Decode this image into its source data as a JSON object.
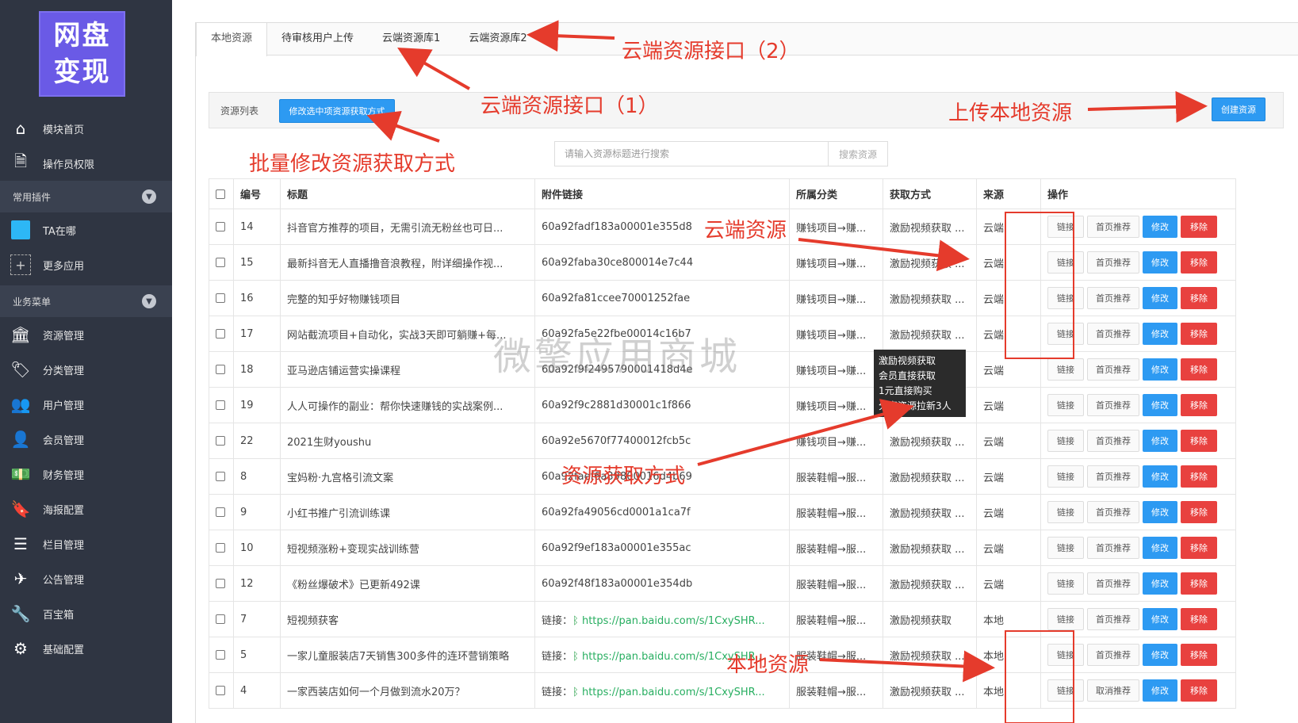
{
  "logo": {
    "line1": "网盘",
    "line2": "变现"
  },
  "sidebar": {
    "top_items": [
      {
        "label": "模块首页",
        "icon": "home-icon"
      },
      {
        "label": "操作员权限",
        "icon": "document-icon"
      }
    ],
    "group_plugins": "常用插件",
    "plugins": [
      {
        "label": "TA在哪",
        "icon": "ta-icon"
      },
      {
        "label": "更多应用",
        "icon": "plus-icon"
      }
    ],
    "group_business": "业务菜单",
    "business": [
      {
        "label": "资源管理",
        "icon": "bank-icon"
      },
      {
        "label": "分类管理",
        "icon": "tag-icon"
      },
      {
        "label": "用户管理",
        "icon": "users-icon"
      },
      {
        "label": "会员管理",
        "icon": "user-icon"
      },
      {
        "label": "财务管理",
        "icon": "money-icon"
      },
      {
        "label": "海报配置",
        "icon": "bookmark-icon"
      },
      {
        "label": "栏目管理",
        "icon": "list-icon"
      },
      {
        "label": "公告管理",
        "icon": "send-icon"
      },
      {
        "label": "百宝箱",
        "icon": "wrench-icon"
      },
      {
        "label": "基础配置",
        "icon": "gears-icon"
      }
    ]
  },
  "tabs": [
    "本地资源",
    "待审核用户上传",
    "云端资源库1",
    "云端资源库2"
  ],
  "toolbar": {
    "list_label": "资源列表",
    "bulk_button": "修改选中项资源获取方式",
    "create_button": "创建资源"
  },
  "search": {
    "placeholder": "请输入资源标题进行搜索",
    "button": "搜索资源"
  },
  "table": {
    "headers": [
      "编号",
      "标题",
      "附件链接",
      "所属分类",
      "获取方式",
      "来源",
      "操作"
    ],
    "op_labels": {
      "link": "链接",
      "home": "首页推荐",
      "home_cancel": "取消推荐",
      "edit": "修改",
      "del": "移除"
    },
    "link_prefix": "链接：",
    "rows": [
      {
        "id": "14",
        "title": "抖音官方推荐的项目，无需引流无粉丝也可日...",
        "attach": "60a92fadf183a00001e355d8",
        "category": "赚钱项目→赚...",
        "method": "激励视频获取 ...",
        "source": "云端"
      },
      {
        "id": "15",
        "title": "最新抖音无人直播撸音浪教程，附详细操作视...",
        "attach": "60a92faba30ce800014e7c44",
        "category": "赚钱项目→赚...",
        "method": "激励视频获取 ...",
        "source": "云端"
      },
      {
        "id": "16",
        "title": "完整的知乎好物赚钱项目",
        "attach": "60a92fa81ccee70001252fae",
        "category": "赚钱项目→赚...",
        "method": "激励视频获取 ...",
        "source": "云端"
      },
      {
        "id": "17",
        "title": "网站截流项目+自动化，实战3天即可躺赚+每...",
        "attach": "60a92fa5e22fbe00014c16b7",
        "category": "赚钱项目→赚...",
        "method": "激励视频获取 ...",
        "source": "云端"
      },
      {
        "id": "18",
        "title": "亚马逊店铺运营实操课程",
        "attach": "60a92f9f2495790001418d4e",
        "category": "赚钱项目→赚...",
        "method": "",
        "source": "云端"
      },
      {
        "id": "19",
        "title": "人人可操作的副业：帮你快速赚钱的实战案例...",
        "attach": "60a92f9c2881d30001c1f866",
        "category": "赚钱项目→赚...",
        "method": "",
        "source": "云端"
      },
      {
        "id": "22",
        "title": "2021生财youshu",
        "attach": "60a92e5670f77400012fcb5c",
        "category": "赚钱项目→赚...",
        "method": "激励视频获取 ...",
        "source": "云端"
      },
      {
        "id": "8",
        "title": "宝妈粉·九宫格引流文案",
        "attach": "60a92faef6a39800016d4b69",
        "category": "服装鞋帽→服...",
        "method": "激励视频获取 ...",
        "source": "云端"
      },
      {
        "id": "9",
        "title": "小红书推广引流训练课",
        "attach": "60a92fa49056cd0001a1ca7f",
        "category": "服装鞋帽→服...",
        "method": "激励视频获取 ...",
        "source": "云端"
      },
      {
        "id": "10",
        "title": "短视频涨粉+变现实战训练营",
        "attach": "60a92f9ef183a00001e355ac",
        "category": "服装鞋帽→服...",
        "method": "激励视频获取 ...",
        "source": "云端"
      },
      {
        "id": "12",
        "title": "《粉丝爆破术》已更新492课",
        "attach": "60a92f48f183a00001e354db",
        "category": "服装鞋帽→服...",
        "method": "激励视频获取 ...",
        "source": "云端"
      },
      {
        "id": "7",
        "title": "短视频获客",
        "attach": "https://pan.baidu.com/s/1CxySHR...",
        "category": "服装鞋帽→服...",
        "method": "激励视频获取",
        "source": "本地"
      },
      {
        "id": "5",
        "title": "一家儿童服装店7天销售300多件的连环营销策略",
        "attach": "https://pan.baidu.com/s/1CxySHR...",
        "category": "服装鞋帽→服...",
        "method": "激励视频获取 ...",
        "source": "本地"
      },
      {
        "id": "4",
        "title": "一家西装店如何一个月做到流水20万？",
        "attach": "https://pan.baidu.com/s/1CxySHR...",
        "category": "服装鞋帽→服...",
        "method": "激励视频获取 ...",
        "source": "本地"
      }
    ]
  },
  "tooltip": [
    "激励视频获取",
    "会员直接获取",
    "1元直接购买",
    "分享资源拉新3人"
  ],
  "watermark": "微擎应用商城",
  "annotations": {
    "cloud_api_2": "云端资源接口（2）",
    "cloud_api_1": "云端资源接口（1）",
    "upload_local": "上传本地资源",
    "bulk_modify": "批量修改资源获取方式",
    "cloud_resource": "云端资源",
    "get_method": "资源获取方式",
    "local_resource": "本地资源"
  },
  "colors": {
    "sidebar": "#2f3542",
    "primary": "#2d9af2",
    "danger": "#e8413f",
    "annotation": "#e53b2c",
    "logo": "#6a5ae6"
  }
}
